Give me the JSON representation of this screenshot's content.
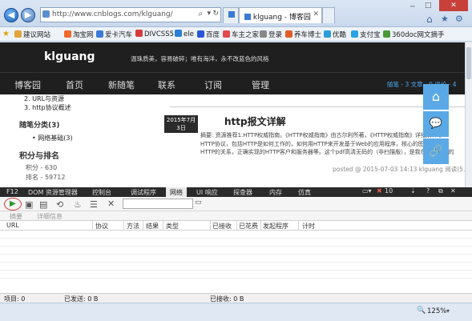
{
  "browser": {
    "url": "http://www.cnblogs.com/klguang/",
    "tab_title": "klguang - 博客园"
  },
  "favorites": [
    {
      "label": "建议网站",
      "color": "#e2a33b"
    },
    {
      "label": "淘宝网",
      "color": "#f2682a"
    },
    {
      "label": "爱卡汽车",
      "color": "#3b7bd6"
    },
    {
      "label": "DIVCSS5",
      "color": "#d63b3b"
    },
    {
      "label": "ele",
      "color": "#2a7fd6"
    },
    {
      "label": "百度",
      "color": "#2a56d6"
    },
    {
      "label": "车主之家",
      "color": "#e04c4c"
    },
    {
      "label": "登录",
      "color": "#888888"
    },
    {
      "label": "养车博士",
      "color": "#e25d2a"
    },
    {
      "label": "优酷",
      "color": "#2a9ed6"
    },
    {
      "label": "支付宝",
      "color": "#2aa3e6"
    },
    {
      "label": "360doc网文摘手",
      "color": "#4a9a3c"
    }
  ],
  "site": {
    "brand": "klguang",
    "tagline": "温珠质美，容易破碎；唯有海洋，永不改蓝色的风格",
    "nav": [
      "博客园",
      "首页",
      "新随笔",
      "联系",
      "订阅",
      "管理"
    ],
    "stats": "随笔 - 3  文章 - 0  评论 - 4",
    "sidebar_links": [
      "2. URL与资源",
      "3. http协议概述"
    ],
    "category_title": "随笔分类(3)",
    "category_items": [
      "网络基础(3)"
    ],
    "rank_title": "积分与排名",
    "rank_items": [
      "积分 - 630",
      "排名 - 59712"
    ],
    "post_date_line1": "2015年7月",
    "post_date_line2": "3日",
    "post_title": "http报文详解",
    "post_summary": "摘要: 资源推荐1.HTTP权威指南。《HTTP权威指南》由古尔利所著，《HTTP权威指南》详细解释了HTTP协议，包括HTTP是如何工作的，如何用HTTP来开发基于Web的应用程序，核心的图解知识与HTTP的关系，正确实现的HTTP客户和服务器等。这个pdf高清无码的（非扫描版），是我在网上购买的",
    "post_meta": "posted @ 2015-07-03 14:13 klguang 阅读(5..."
  },
  "devtools": {
    "tabs": [
      "F12",
      "DOM 资源管理器",
      "控制台",
      "调试程序",
      "网络",
      "UI 响应",
      "探查器",
      "内存",
      "仿真"
    ],
    "active_tab": "网络",
    "error_count": "10",
    "subtabs": [
      "摘要",
      "详细信息"
    ],
    "columns": [
      "URL",
      "协议",
      "方法",
      "结果",
      "类型",
      "已接收",
      "已花费",
      "发起程序",
      "计时"
    ],
    "status": {
      "items": "项目: 0",
      "sent": "已发送: 0 B",
      "received": "已接收: 0 B"
    }
  },
  "zoom": "125%"
}
